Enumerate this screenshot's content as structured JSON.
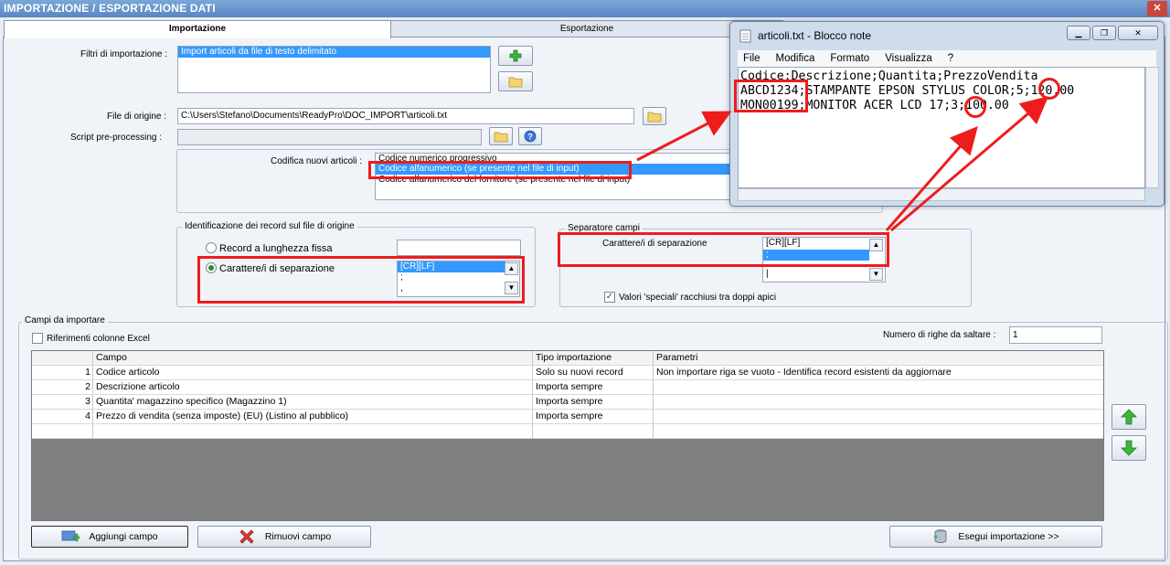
{
  "window": {
    "title": "IMPORTAZIONE / ESPORTAZIONE DATI",
    "close": "✕"
  },
  "tabs": [
    {
      "label": "Importazione"
    },
    {
      "label": "Esportazione"
    }
  ],
  "filters": {
    "label": "Filtri di importazione :",
    "items": [
      "Import articoli da file di testo delimitato"
    ]
  },
  "source": {
    "file_label": "File di origine :",
    "file_value": "C:\\Users\\Stefano\\Documents\\ReadyPro\\DOC_IMPORT\\articoli.txt",
    "script_label": "Script pre-processing :",
    "script_value": ""
  },
  "codifica": {
    "label": "Codifica nuovi articoli :",
    "options": [
      "Codice numerico progressivo",
      "Codice alfanumerico (se presente nel file di input)",
      "Codice alfanumerico del fornitore (se presente nel file di input)"
    ]
  },
  "record_group": {
    "title": "Identificazione dei record sul file di origine",
    "fixed_label": "Record a lunghezza fissa",
    "sep_label": "Carattere/i di separazione",
    "list": [
      "[CR][LF]",
      ";",
      ","
    ]
  },
  "fields_sep_group": {
    "title": "Separatore campi",
    "sep_label": "Carattere/i di separazione",
    "list": [
      "[CR][LF]",
      ";",
      "|"
    ],
    "quotes_label": "Valori 'speciali' racchiusi tra doppi apici",
    "quotes_mark": "✓"
  },
  "campi": {
    "title": "Campi da importare",
    "excel_label": "Riferimenti colonne Excel",
    "skip_label": "Numero di righe da saltare :",
    "skip_value": "1",
    "columns": [
      "Campo",
      "Tipo importazione",
      "Parametri"
    ],
    "rows": [
      {
        "n": "1",
        "campo": "Codice articolo",
        "tipo": "Solo su nuovi record",
        "param": "Non importare riga se vuoto - Identifica record esistenti da aggiornare"
      },
      {
        "n": "2",
        "campo": "Descrizione articolo",
        "tipo": "Importa sempre",
        "param": ""
      },
      {
        "n": "3",
        "campo": "Quantita' magazzino specifico (Magazzino 1)",
        "tipo": "Importa sempre",
        "param": ""
      },
      {
        "n": "4",
        "campo": "Prezzo di vendita (senza imposte) (EU) (Listino al pubblico)",
        "tipo": "Importa sempre",
        "param": ""
      }
    ]
  },
  "buttons": {
    "add": "Aggiungi campo",
    "remove": "Rimuovi campo",
    "run": "Esegui importazione >>"
  },
  "notepad": {
    "title": "articoli.txt - Blocco note",
    "menu": [
      "File",
      "Modifica",
      "Formato",
      "Visualizza",
      "?"
    ],
    "lines": [
      "Codice;Descrizione;Quantita;PrezzoVendita",
      "ABCD1234;STAMPANTE EPSON STYLUS COLOR;5;120.00",
      "MON00199;MONITOR ACER LCD 17;3;100.00"
    ],
    "btn_min": "▁",
    "btn_max": "❐",
    "btn_close": "✕"
  },
  "colors": {
    "annotation": "#ee1c1c",
    "selection": "#3399ff",
    "titlebar": "#5a87c2"
  }
}
